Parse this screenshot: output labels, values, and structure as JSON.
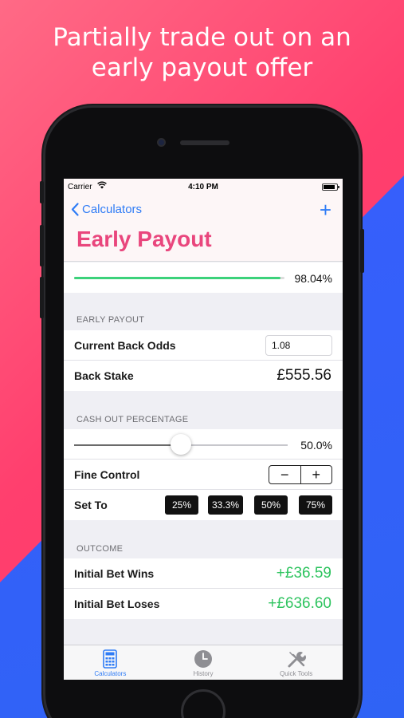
{
  "headline": {
    "line1": "Partially trade out on an",
    "line2": "early payout offer"
  },
  "status_bar": {
    "carrier": "Carrier",
    "time": "4:10 PM",
    "battery_level": 0.85
  },
  "nav": {
    "back_label": "Calculators",
    "add_label": "+",
    "title": "Early Payout"
  },
  "progress": {
    "percent_label": "98.04%",
    "fraction": 0.9804
  },
  "early_payout": {
    "header": "EARLY PAYOUT",
    "current_back_odds_label": "Current Back Odds",
    "current_back_odds_value": "1.08",
    "back_stake_label": "Back Stake",
    "back_stake_value": "£555.56"
  },
  "cash_out": {
    "header": "CASH OUT PERCENTAGE",
    "slider_label": "50.0%",
    "slider_fraction": 0.5,
    "fine_control_label": "Fine Control",
    "minus_label": "−",
    "plus_label": "+",
    "set_to_label": "Set To",
    "presets": [
      "25%",
      "33.3%",
      "50%",
      "75%"
    ]
  },
  "outcome": {
    "header": "OUTCOME",
    "wins_label": "Initial Bet Wins",
    "wins_value": "+£36.59",
    "loses_label": "Initial Bet Loses",
    "loses_value": "+£636.60"
  },
  "tabs": [
    {
      "label": "Calculators",
      "icon": "calculator-icon",
      "active": true
    },
    {
      "label": "History",
      "icon": "clock-icon",
      "active": false
    },
    {
      "label": "Quick Tools",
      "icon": "tools-icon",
      "active": false
    }
  ],
  "colors": {
    "accent": "#2f7cf6",
    "title": "#e9467d",
    "positive": "#2ec45f",
    "progress": "#3cd27b"
  }
}
